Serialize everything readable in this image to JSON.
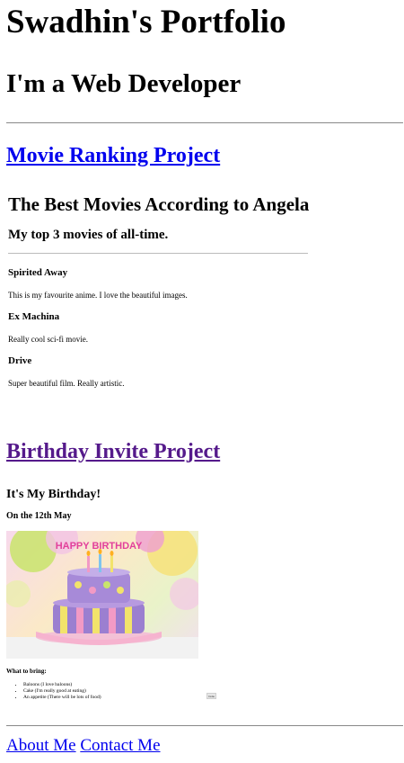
{
  "header": {
    "title": "Swadhin's Portfolio",
    "subtitle": "I'm a Web Developer"
  },
  "projects": {
    "movie_link": "Movie Ranking Project",
    "birthday_link": "Birthday Invite Project"
  },
  "movie_preview": {
    "heading": "The Best Movies According to Angela",
    "subheading": "My top 3 movies of all-time.",
    "movies": [
      {
        "title": "Spirited Away",
        "desc": "This is my favourite anime. I love the beautiful images."
      },
      {
        "title": "Ex Machina",
        "desc": "Really cool sci-fi movie."
      },
      {
        "title": "Drive",
        "desc": "Super beautiful film. Really artistic."
      }
    ]
  },
  "birthday_preview": {
    "heading": "It's My Birthday!",
    "date": "On the 12th May",
    "cake_banner": "HAPPY BIRTHDAY",
    "bring_heading": "What to bring:",
    "bring_items": [
      "Baloons (I love baloons)",
      "Cake (I'm really good at eating)",
      "An appetite (There will be lots of food)"
    ],
    "rsvp_label": "Invite"
  },
  "footer": {
    "about": "About Me",
    "contact": "Contact Me"
  },
  "colors": {
    "link": "#0000ee",
    "visited_link": "#551a8b"
  }
}
